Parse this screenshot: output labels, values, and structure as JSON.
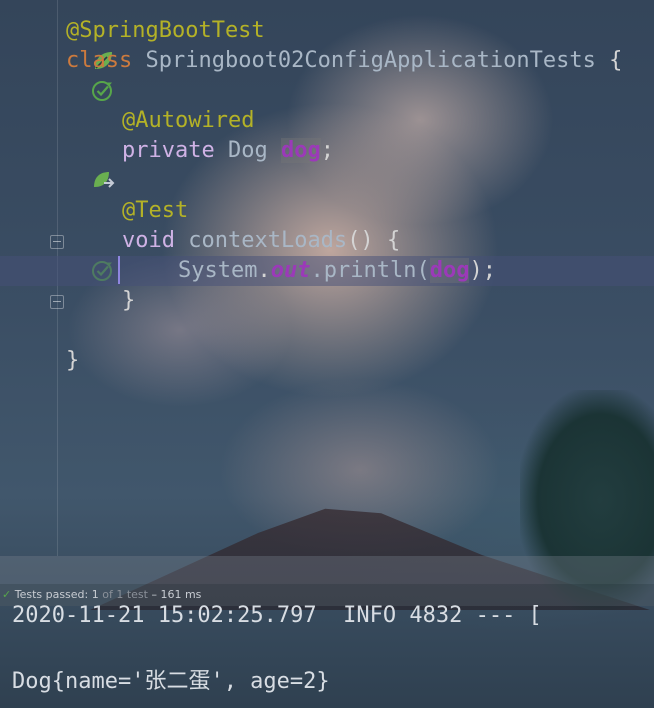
{
  "editor": {
    "lines": [
      {
        "type": "annot",
        "text": "@SpringBootTest",
        "icon": "spring-leaf-icon"
      },
      {
        "type": "class",
        "kw": "class",
        "name": "Springboot02ConfigApplicationTests",
        "brace": "{",
        "icon": "test-passed-icon"
      },
      {
        "type": "blank"
      },
      {
        "type": "annot2",
        "text": "@Autowired"
      },
      {
        "type": "field",
        "kw": "private",
        "type_name": "Dog",
        "var": "dog",
        "semi": ";",
        "icon": "bean-navigate-icon"
      },
      {
        "type": "blank"
      },
      {
        "type": "annot2",
        "text": "@Test"
      },
      {
        "type": "method",
        "kw": "void",
        "name": "contextLoads",
        "params": "()",
        "brace": "{",
        "icon": "test-passed-icon"
      },
      {
        "type": "stmt",
        "obj": "System",
        "dot": ".",
        "out": "out",
        "call": ".println(",
        "arg": "dog",
        "end": ");"
      },
      {
        "type": "close1",
        "text": "}"
      },
      {
        "type": "blank"
      },
      {
        "type": "close0",
        "text": "}"
      }
    ]
  },
  "status": {
    "label": "Tests passed:",
    "passed": "1",
    "of_total": "of 1 test",
    "duration": "– 161 ms"
  },
  "console": {
    "log_line": "2020-11-21 15:02:25.797  INFO 4832 --- [",
    "output_line": "Dog{name='张二蛋', age=2}"
  },
  "colors": {
    "annotation": "#b4b227",
    "keyword": "#cc7a3e",
    "field": "#9b3ab8",
    "test_passed": "#57a64a"
  }
}
